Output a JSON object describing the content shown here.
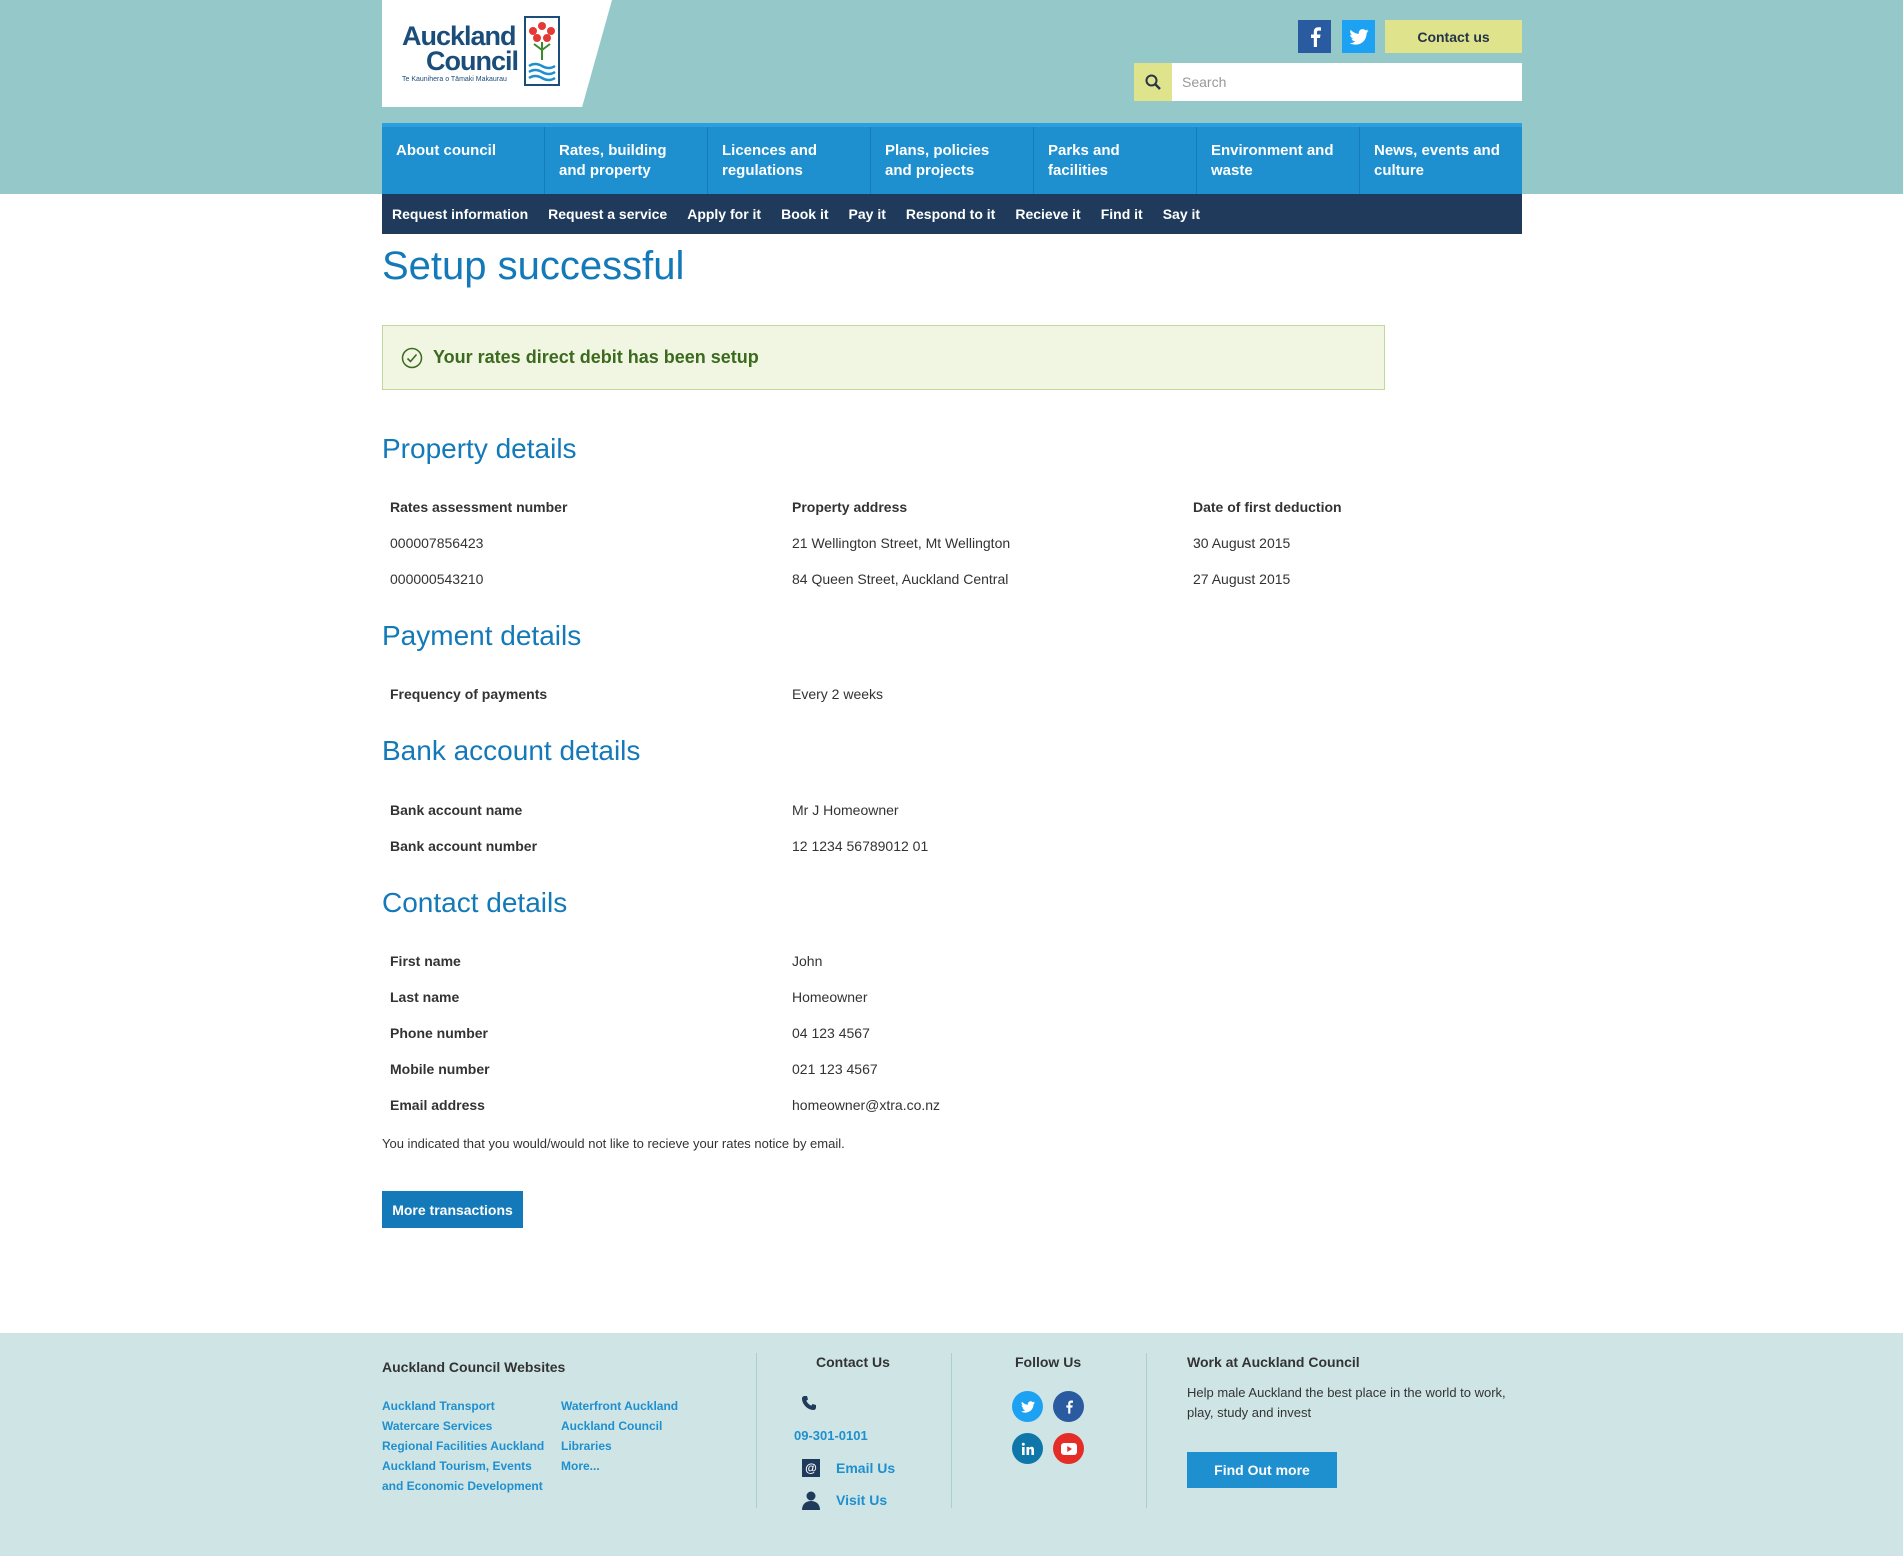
{
  "header": {
    "logo": {
      "line1": "Auckland",
      "line2": "Council",
      "tagline": "Te Kaunihera o Tāmaki Makaurau"
    },
    "contact_label": "Contact us",
    "search_placeholder": "Search"
  },
  "main_nav": [
    "About council",
    "Rates, building and property",
    "Licences and regulations",
    "Plans, policies and projects",
    "Parks and facilities",
    "Environment and waste",
    "News, events and culture"
  ],
  "sub_nav": [
    "Request information",
    "Request a service",
    "Apply for it",
    "Book it",
    "Pay it",
    "Respond to it",
    "Recieve it",
    "Find it",
    "Say it"
  ],
  "page_title": "Setup successful",
  "success_message": "Your rates direct debit has been setup",
  "property": {
    "heading": "Property details",
    "columns": [
      "Rates assessment number",
      "Property address",
      "Date of first deduction"
    ],
    "rows": [
      [
        "000007856423",
        "21 Wellington Street, Mt Wellington",
        "30 August 2015"
      ],
      [
        "000000543210",
        "84 Queen Street, Auckland Central",
        "27 August 2015"
      ]
    ]
  },
  "payment": {
    "heading": "Payment details",
    "rows": [
      [
        "Frequency of payments",
        "Every 2 weeks"
      ]
    ]
  },
  "bank": {
    "heading": "Bank account details",
    "rows": [
      [
        "Bank account name",
        "Mr J Homeowner"
      ],
      [
        "Bank account number",
        "12 1234 56789012 01"
      ]
    ]
  },
  "contact": {
    "heading": "Contact details",
    "rows": [
      [
        "First name",
        "John"
      ],
      [
        "Last name",
        "Homeowner"
      ],
      [
        "Phone number",
        "04 123 4567"
      ],
      [
        "Mobile number",
        "021 123 4567"
      ],
      [
        "Email address",
        "homeowner@xtra.co.nz"
      ]
    ]
  },
  "note": "You indicated that you would/would not like to recieve your rates notice by email.",
  "more_button": "More transactions",
  "footer": {
    "websites_heading": "Auckland Council Websites",
    "websites_col1": [
      "Auckland Transport",
      "Watercare Services",
      "Regional Facilities Auckland",
      "Auckland Tourism, Events",
      "and Economic Development"
    ],
    "websites_col2": [
      "Waterfront Auckland",
      "Auckland Council",
      "Libraries",
      "More..."
    ],
    "contact_heading": "Contact Us",
    "phone": "09-301-0101",
    "email_label": "Email Us",
    "visit_label": "Visit Us",
    "follow_heading": "Follow Us",
    "work_heading": "Work at Auckland Council",
    "work_text": "Help male Auckland the best place in the world to work, play, study and invest",
    "find_out_label": "Find Out more"
  },
  "colors": {
    "brand_blue": "#1479b8",
    "nav_blue": "#1e8fcf",
    "subnav_dark": "#1f3a5a",
    "header_teal": "#95c9c9",
    "accent_yellow": "#dfe38c",
    "success_green": "#3c6a1e"
  }
}
